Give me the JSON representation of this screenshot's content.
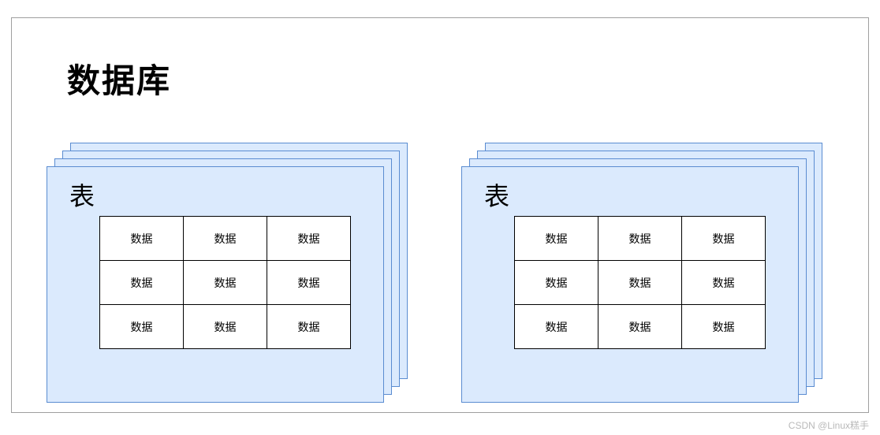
{
  "title": "数据库",
  "stacks": [
    {
      "label": "表",
      "grid": [
        [
          "数据",
          "数据",
          "数据"
        ],
        [
          "数据",
          "数据",
          "数据"
        ],
        [
          "数据",
          "数据",
          "数据"
        ]
      ]
    },
    {
      "label": "表",
      "grid": [
        [
          "数据",
          "数据",
          "数据"
        ],
        [
          "数据",
          "数据",
          "数据"
        ],
        [
          "数据",
          "数据",
          "数据"
        ]
      ]
    }
  ],
  "watermark": "CSDN @Linux糕手"
}
